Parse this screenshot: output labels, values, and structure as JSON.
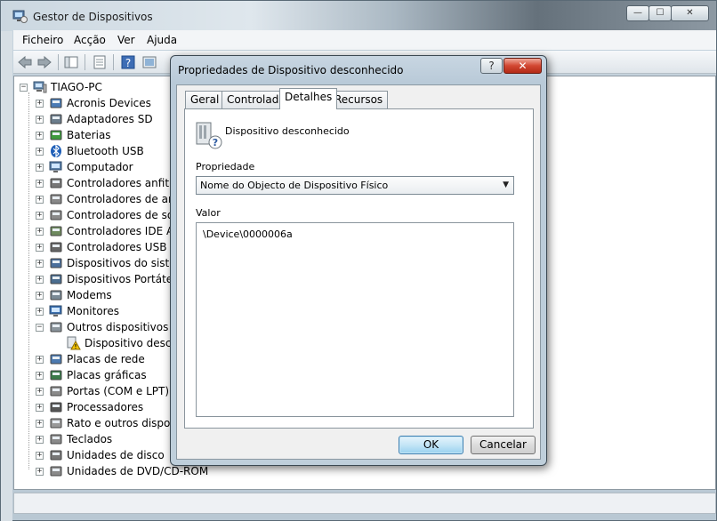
{
  "window": {
    "title": "Gestor de Dispositivos",
    "caption_min": "—",
    "caption_max": "☐",
    "caption_close": "✕"
  },
  "menubar": {
    "items": [
      "Ficheiro",
      "Acção",
      "Ver",
      "Ajuda"
    ]
  },
  "toolbar": {
    "buttons": [
      "back-icon",
      "forward-icon",
      "show-hide-console-tree-icon",
      "properties-icon",
      "help-icon",
      "console-icon",
      "scan-hardware-icon",
      "update-driver-icon",
      "uninstall-icon"
    ]
  },
  "tree": {
    "root": "TIAGO-PC",
    "items": [
      {
        "label": "Acronis Devices",
        "icon": "device-icon",
        "expander": "+"
      },
      {
        "label": "Adaptadores SD",
        "icon": "sd-adapter-icon",
        "expander": "+"
      },
      {
        "label": "Baterias",
        "icon": "battery-icon",
        "expander": "+"
      },
      {
        "label": "Bluetooth USB",
        "icon": "bluetooth-icon",
        "expander": "+"
      },
      {
        "label": "Computador",
        "icon": "computer-icon",
        "expander": "+"
      },
      {
        "label": "Controladores anfitriã",
        "icon": "usb-host-icon",
        "expander": "+"
      },
      {
        "label": "Controladores de arm",
        "icon": "storage-controller-icon",
        "expander": "+"
      },
      {
        "label": "Controladores de som",
        "icon": "sound-icon",
        "expander": "+"
      },
      {
        "label": "Controladores IDE AT",
        "icon": "ide-icon",
        "expander": "+"
      },
      {
        "label": "Controladores USB (U",
        "icon": "usb-icon",
        "expander": "+"
      },
      {
        "label": "Dispositivos do sistem",
        "icon": "system-device-icon",
        "expander": "+"
      },
      {
        "label": "Dispositivos Portáteis",
        "icon": "portable-device-icon",
        "expander": "+"
      },
      {
        "label": "Modems",
        "icon": "modem-icon",
        "expander": "+"
      },
      {
        "label": "Monitores",
        "icon": "monitor-icon",
        "expander": "+"
      },
      {
        "label": "Outros dispositivos",
        "icon": "other-devices-icon",
        "expander": "−"
      },
      {
        "label": "Dispositivo desco",
        "icon": "unknown-device-warning-icon",
        "expander": "",
        "child": true
      },
      {
        "label": "Placas de rede",
        "icon": "network-icon",
        "expander": "+"
      },
      {
        "label": "Placas gráficas",
        "icon": "display-adapter-icon",
        "expander": "+"
      },
      {
        "label": "Portas (COM e LPT)",
        "icon": "port-icon",
        "expander": "+"
      },
      {
        "label": "Processadores",
        "icon": "processor-icon",
        "expander": "+"
      },
      {
        "label": "Rato e outros disposit",
        "icon": "mouse-icon",
        "expander": "+"
      },
      {
        "label": "Teclados",
        "icon": "keyboard-icon",
        "expander": "+"
      },
      {
        "label": "Unidades de disco",
        "icon": "disk-icon",
        "expander": "+"
      },
      {
        "label": "Unidades de DVD/CD-ROM",
        "icon": "dvd-icon",
        "expander": "+"
      }
    ]
  },
  "dialog": {
    "title": "Propriedades de Dispositivo desconhecido",
    "help_label": "?",
    "close_label": "✕",
    "tabs": [
      "Geral",
      "Controlador",
      "Detalhes",
      "Recursos"
    ],
    "active_tab": "Detalhes",
    "device_name": "Dispositivo desconhecido",
    "property_label": "Propriedade",
    "property_selected": "Nome do Objecto de Dispositivo Físico",
    "value_label": "Valor",
    "value_text": "\\Device\\0000006a",
    "ok_label": "OK",
    "cancel_label": "Cancelar"
  }
}
